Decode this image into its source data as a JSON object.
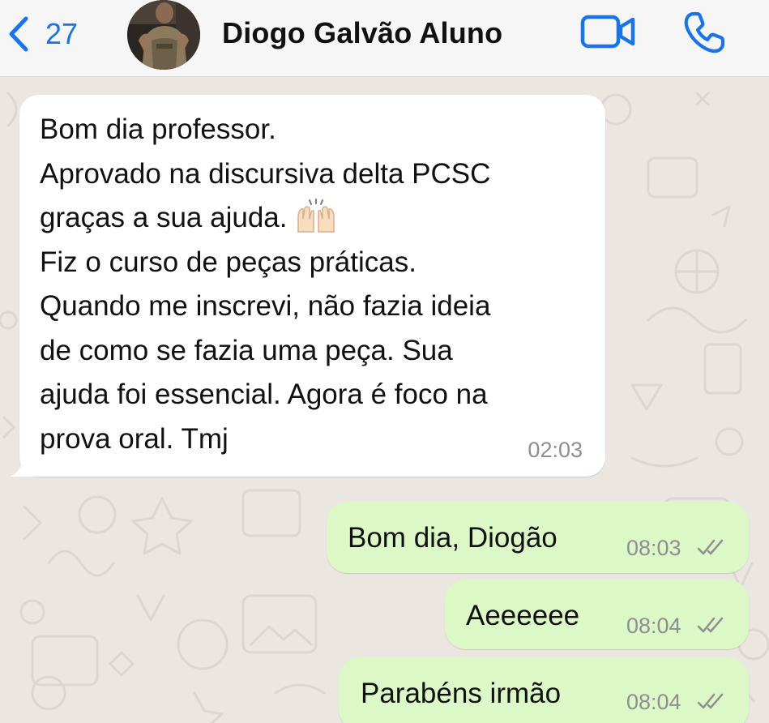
{
  "header": {
    "back_count": "27",
    "contact_name": "Diogo Galvão Aluno",
    "icons": [
      "chevron-left-icon",
      "video-call-icon",
      "phone-call-icon"
    ],
    "accent_color": "#1a73e8"
  },
  "messages": [
    {
      "direction": "incoming",
      "text": "Bom dia professor.\nAprovado na discursiva delta PCSC\ngraças a sua ajuda.",
      "emoji": "raising-hands-emoji",
      "text_after": "Fiz o curso de peças práticas.\nQuando me inscrevi, não fazia ideia\nde como se fazia uma peça. Sua\najuda foi essencial. Agora é foco na\nprova oral. Tmj",
      "time": "02:03"
    },
    {
      "direction": "outgoing",
      "text": "Bom dia, Diogão",
      "time": "08:03",
      "status": "read"
    },
    {
      "direction": "outgoing",
      "text": "Aeeeeee",
      "time": "08:04",
      "status": "read"
    },
    {
      "direction": "outgoing",
      "text": "Parabéns irmão",
      "time": "08:04",
      "status": "read"
    }
  ],
  "colors": {
    "chat_background": "#ebe6df",
    "incoming_bubble": "#ffffff",
    "outgoing_bubble": "#dcf8c6"
  }
}
